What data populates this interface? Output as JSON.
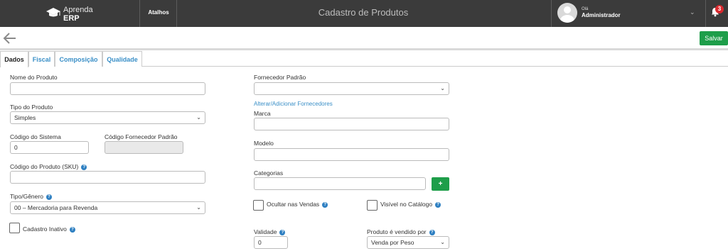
{
  "header": {
    "logo_line1": "Aprenda",
    "logo_line2": "ERP",
    "shortcuts_label": "Atalhos",
    "title": "Cadastro de Produtos",
    "greeting": "Olá",
    "user_name": "Administrador",
    "notification_count": "3"
  },
  "toolbar": {
    "save_label": "Salvar"
  },
  "tabs": [
    {
      "label": "Dados",
      "active": true
    },
    {
      "label": "Fiscal"
    },
    {
      "label": "Composição"
    },
    {
      "label": "Qualidade"
    }
  ],
  "form": {
    "product_name": {
      "label": "Nome do Produto",
      "value": ""
    },
    "product_type": {
      "label": "Tipo do Produto",
      "value": "Simples"
    },
    "system_code": {
      "label": "Código do Sistema",
      "value": "0"
    },
    "supplier_code": {
      "label": "Código Fornecedor Padrão",
      "value": ""
    },
    "sku": {
      "label": "Código do Produto (SKU)",
      "value": ""
    },
    "type_genre": {
      "label": "Tipo/Gênero",
      "value": "00 – Mercadoria para Revenda"
    },
    "inactive": {
      "label": "Cadastro Inativo",
      "checked": false
    },
    "default_supplier": {
      "label": "Fornecedor Padrão",
      "value": ""
    },
    "change_suppliers_link": "Alterar/Adicionar Fornecedores",
    "brand": {
      "label": "Marca",
      "value": ""
    },
    "model": {
      "label": "Modelo",
      "value": ""
    },
    "categories": {
      "label": "Categorias",
      "value": "",
      "add_label": "+"
    },
    "hide_in_sales": {
      "label": "Ocultar nas Vendas",
      "checked": false
    },
    "visible_in_catalog": {
      "label": "Visível no Catálogo",
      "checked": false
    },
    "validity": {
      "label": "Validade",
      "value": "0"
    },
    "sold_by": {
      "label": "Produto é vendido por",
      "value": "Venda por Peso"
    }
  },
  "colors": {
    "topbar": "#3b3b3b",
    "accent_green": "#1e9e4a",
    "link_blue": "#3a8fc7",
    "badge_red": "#d9292e"
  }
}
